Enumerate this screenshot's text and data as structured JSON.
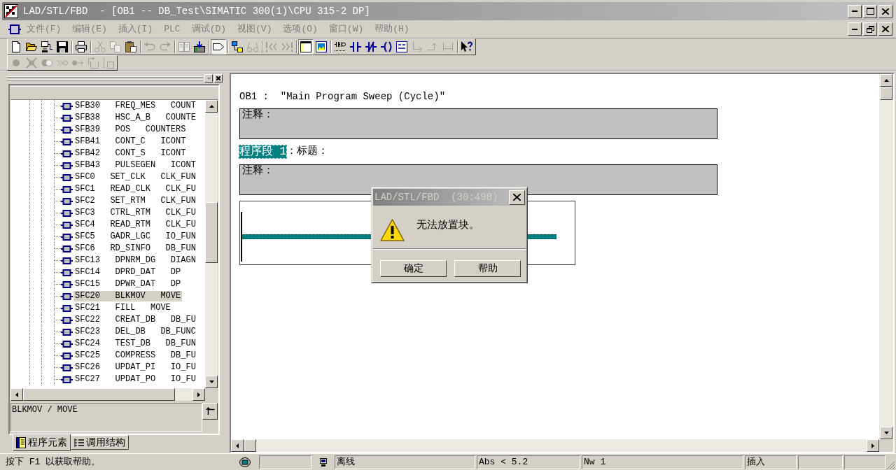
{
  "window": {
    "title": "LAD/STL/FBD  - [OB1 -- DB_Test\\SIMATIC 300(1)\\CPU 315-2 DP]"
  },
  "menu": [
    {
      "label": "文件(F)",
      "disabled": true
    },
    {
      "label": "编辑(E)",
      "disabled": true
    },
    {
      "label": "插入(I)",
      "disabled": true
    },
    {
      "label": "PLC",
      "disabled": true
    },
    {
      "label": "调试(D)",
      "disabled": true
    },
    {
      "label": "视图(V)",
      "disabled": true
    },
    {
      "label": "选项(O)",
      "disabled": true
    },
    {
      "label": "窗口(W)",
      "disabled": true
    },
    {
      "label": "帮助(H)",
      "disabled": true
    }
  ],
  "toolbar": [
    [
      {
        "kind": "new",
        "pressed": false,
        "disabled": false
      },
      {
        "kind": "open",
        "pressed": false,
        "disabled": false
      },
      {
        "kind": "nodes",
        "pressed": false,
        "disabled": false
      },
      {
        "kind": "save",
        "pressed": false,
        "disabled": false
      }
    ],
    [
      {
        "kind": "print",
        "pressed": false,
        "disabled": false
      }
    ],
    [
      {
        "kind": "cut",
        "pressed": false,
        "disabled": true
      },
      {
        "kind": "copy",
        "pressed": false,
        "disabled": true
      },
      {
        "kind": "paste",
        "pressed": false,
        "disabled": false
      }
    ],
    [
      {
        "kind": "undo",
        "pressed": false,
        "disabled": true
      },
      {
        "kind": "redo",
        "pressed": false,
        "disabled": true
      }
    ],
    [
      {
        "kind": "module",
        "pressed": false,
        "disabled": true
      },
      {
        "kind": "download",
        "pressed": false,
        "disabled": false
      }
    ],
    [
      {
        "kind": "tag",
        "pressed": true,
        "disabled": false
      }
    ],
    [
      {
        "kind": "network",
        "pressed": false,
        "disabled": false
      },
      {
        "kind": "glasses",
        "pressed": false,
        "disabled": true
      }
    ],
    [
      {
        "kind": "skip_back",
        "pressed": false,
        "disabled": true
      },
      {
        "kind": "skip_forward",
        "pressed": false,
        "disabled": true
      }
    ],
    [
      {
        "kind": "panel",
        "pressed": true,
        "disabled": false
      },
      {
        "kind": "image",
        "pressed": false,
        "disabled": false
      }
    ],
    [
      {
        "kind": "contacts",
        "pressed": false,
        "disabled": false
      },
      {
        "kind": "no_contact",
        "pressed": false,
        "disabled": false
      },
      {
        "kind": "nc_contact",
        "pressed": false,
        "disabled": false
      },
      {
        "kind": "coil",
        "pressed": false,
        "disabled": false
      },
      {
        "kind": "box",
        "pressed": false,
        "disabled": false
      },
      {
        "kind": "branch_open",
        "pressed": false,
        "disabled": true
      },
      {
        "kind": "branch_close",
        "pressed": false,
        "disabled": true
      },
      {
        "kind": "connector",
        "pressed": false,
        "disabled": true
      }
    ],
    [
      {
        "kind": "help",
        "pressed": false,
        "disabled": false
      }
    ]
  ],
  "toolbar_2": [
    [
      {
        "kind": "dot",
        "pressed": false,
        "disabled": true
      },
      {
        "kind": "crossed",
        "pressed": false,
        "disabled": true
      },
      {
        "kind": "circles",
        "pressed": false,
        "disabled": true
      },
      {
        "kind": "chevron_dot",
        "pressed": false,
        "disabled": true
      },
      {
        "kind": "dot_arrow",
        "pressed": false,
        "disabled": true
      },
      {
        "kind": "arrow_box",
        "pressed": false,
        "disabled": true
      },
      {
        "kind": "cursor_box",
        "pressed": false,
        "disabled": true
      }
    ]
  ],
  "element_browser": {
    "rows": [
      {
        "text": "SFB30   FREQ_MES   COUNT",
        "selected": false
      },
      {
        "text": "SFB38   HSC_A_B   COUNTE",
        "selected": false
      },
      {
        "text": "SFB39   POS   COUNTERS",
        "selected": false
      },
      {
        "text": "SFB41   CONT_C   ICONT",
        "selected": false
      },
      {
        "text": "SFB42   CONT_S   ICONT",
        "selected": false
      },
      {
        "text": "SFB43   PULSEGEN   ICONT",
        "selected": false
      },
      {
        "text": "SFC0   SET_CLK   CLK_FUN",
        "selected": false
      },
      {
        "text": "SFC1   READ_CLK   CLK_FU",
        "selected": false
      },
      {
        "text": "SFC2   SET_RTM   CLK_FUN",
        "selected": false
      },
      {
        "text": "SFC3   CTRL_RTM   CLK_FU",
        "selected": false
      },
      {
        "text": "SFC4   READ_RTM   CLK_FU",
        "selected": false
      },
      {
        "text": "SFC5   GADR_LGC   IO_FUN",
        "selected": false
      },
      {
        "text": "SFC6   RD_SINFO   DB_FUN",
        "selected": false
      },
      {
        "text": "SFC13   DPNRM_DG   DIAGN",
        "selected": false
      },
      {
        "text": "SFC14   DPRD_DAT   DP",
        "selected": false
      },
      {
        "text": "SFC15   DPWR_DAT   DP",
        "selected": false
      },
      {
        "text": "SFC20   BLKMOV   MOVE",
        "selected": true
      },
      {
        "text": "SFC21   FILL   MOVE",
        "selected": false
      },
      {
        "text": "SFC22   CREAT_DB   DB_FU",
        "selected": false
      },
      {
        "text": "SFC23   DEL_DB   DB_FUNC",
        "selected": false
      },
      {
        "text": "SFC24   TEST_DB   DB_FUN",
        "selected": false
      },
      {
        "text": "SFC25   COMPRESS   DB_FU",
        "selected": false
      },
      {
        "text": "SFC26   UPDAT_PI   IO_FU",
        "selected": false
      },
      {
        "text": "SFC27   UPDAT_PO   IO_FU",
        "selected": false
      }
    ],
    "description": "BLKMOV / MOVE",
    "tabs": [
      {
        "label": "程序元素",
        "kind": "elements",
        "selected": true
      },
      {
        "label": "调用结构",
        "kind": "structure",
        "selected": false
      }
    ]
  },
  "editor": {
    "block_title": "OB1 :  \"Main Program Sweep (Cycle)\"",
    "block_comment": "注释：",
    "networks": [
      {
        "label": "程序段 1",
        "selected": true,
        "title": "：标题：",
        "comment": "注释："
      }
    ]
  },
  "dialog": {
    "title": "LAD/STL/FBD  (30:498)",
    "message": "无法放置块。",
    "buttons": [
      "确定",
      "帮助"
    ]
  },
  "status_bar": {
    "message": "按下 F1 以获取帮助。",
    "connection": "离线",
    "address": "Abs < 5.2",
    "network": "Nw 1",
    "edit_mode": "插入"
  }
}
